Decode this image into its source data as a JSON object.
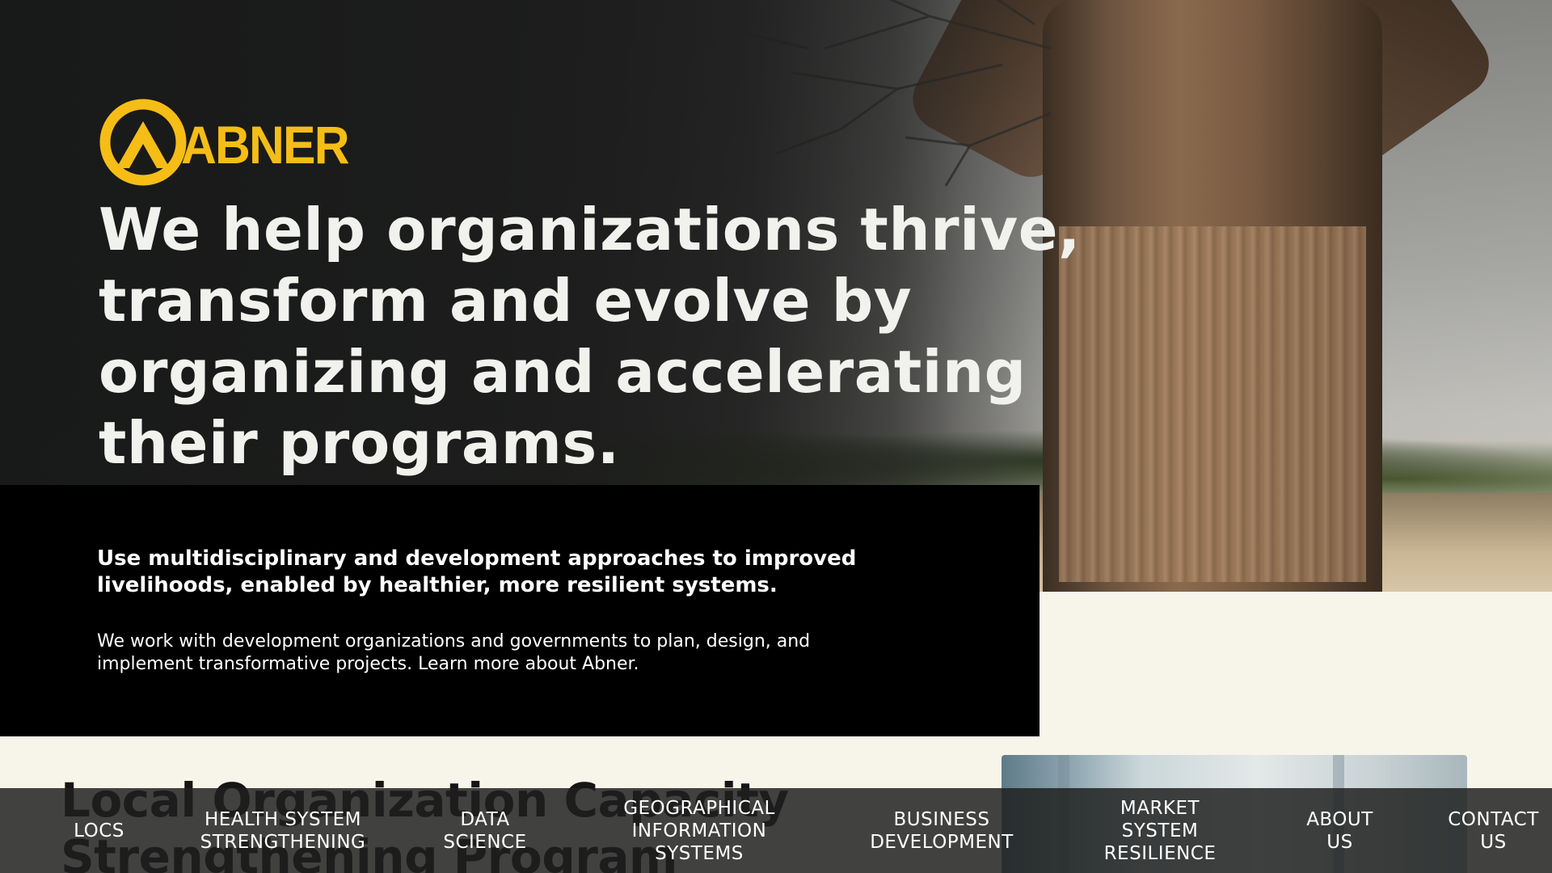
{
  "brand": {
    "name": "ABNER",
    "accent_color": "#f5bd16"
  },
  "hero": {
    "headline": "We help organizations thrive, transform and evolve by organizing and accelerating their programs.",
    "lead": "Use multidisciplinary and development approaches to improved livelihoods, enabled by healthier, more resilient systems.",
    "body": "We work with development organizations and governments to plan, design, and implement transformative projects. Learn more about Abner."
  },
  "section": {
    "title": "Local Organization Capacity Strengthening Program"
  },
  "nav": {
    "items": [
      {
        "label": "LOCS"
      },
      {
        "label": "HEALTH SYSTEM STRENGTHENING"
      },
      {
        "label": "DATA SCIENCE"
      },
      {
        "label": "GEOGRAPHICAL INFORMATION SYSTEMS"
      },
      {
        "label": "BUSINESS DEVELOPMENT"
      },
      {
        "label": "MARKET SYSTEM RESILIENCE"
      },
      {
        "label": "ABOUT US"
      },
      {
        "label": "CONTACT US"
      }
    ]
  }
}
